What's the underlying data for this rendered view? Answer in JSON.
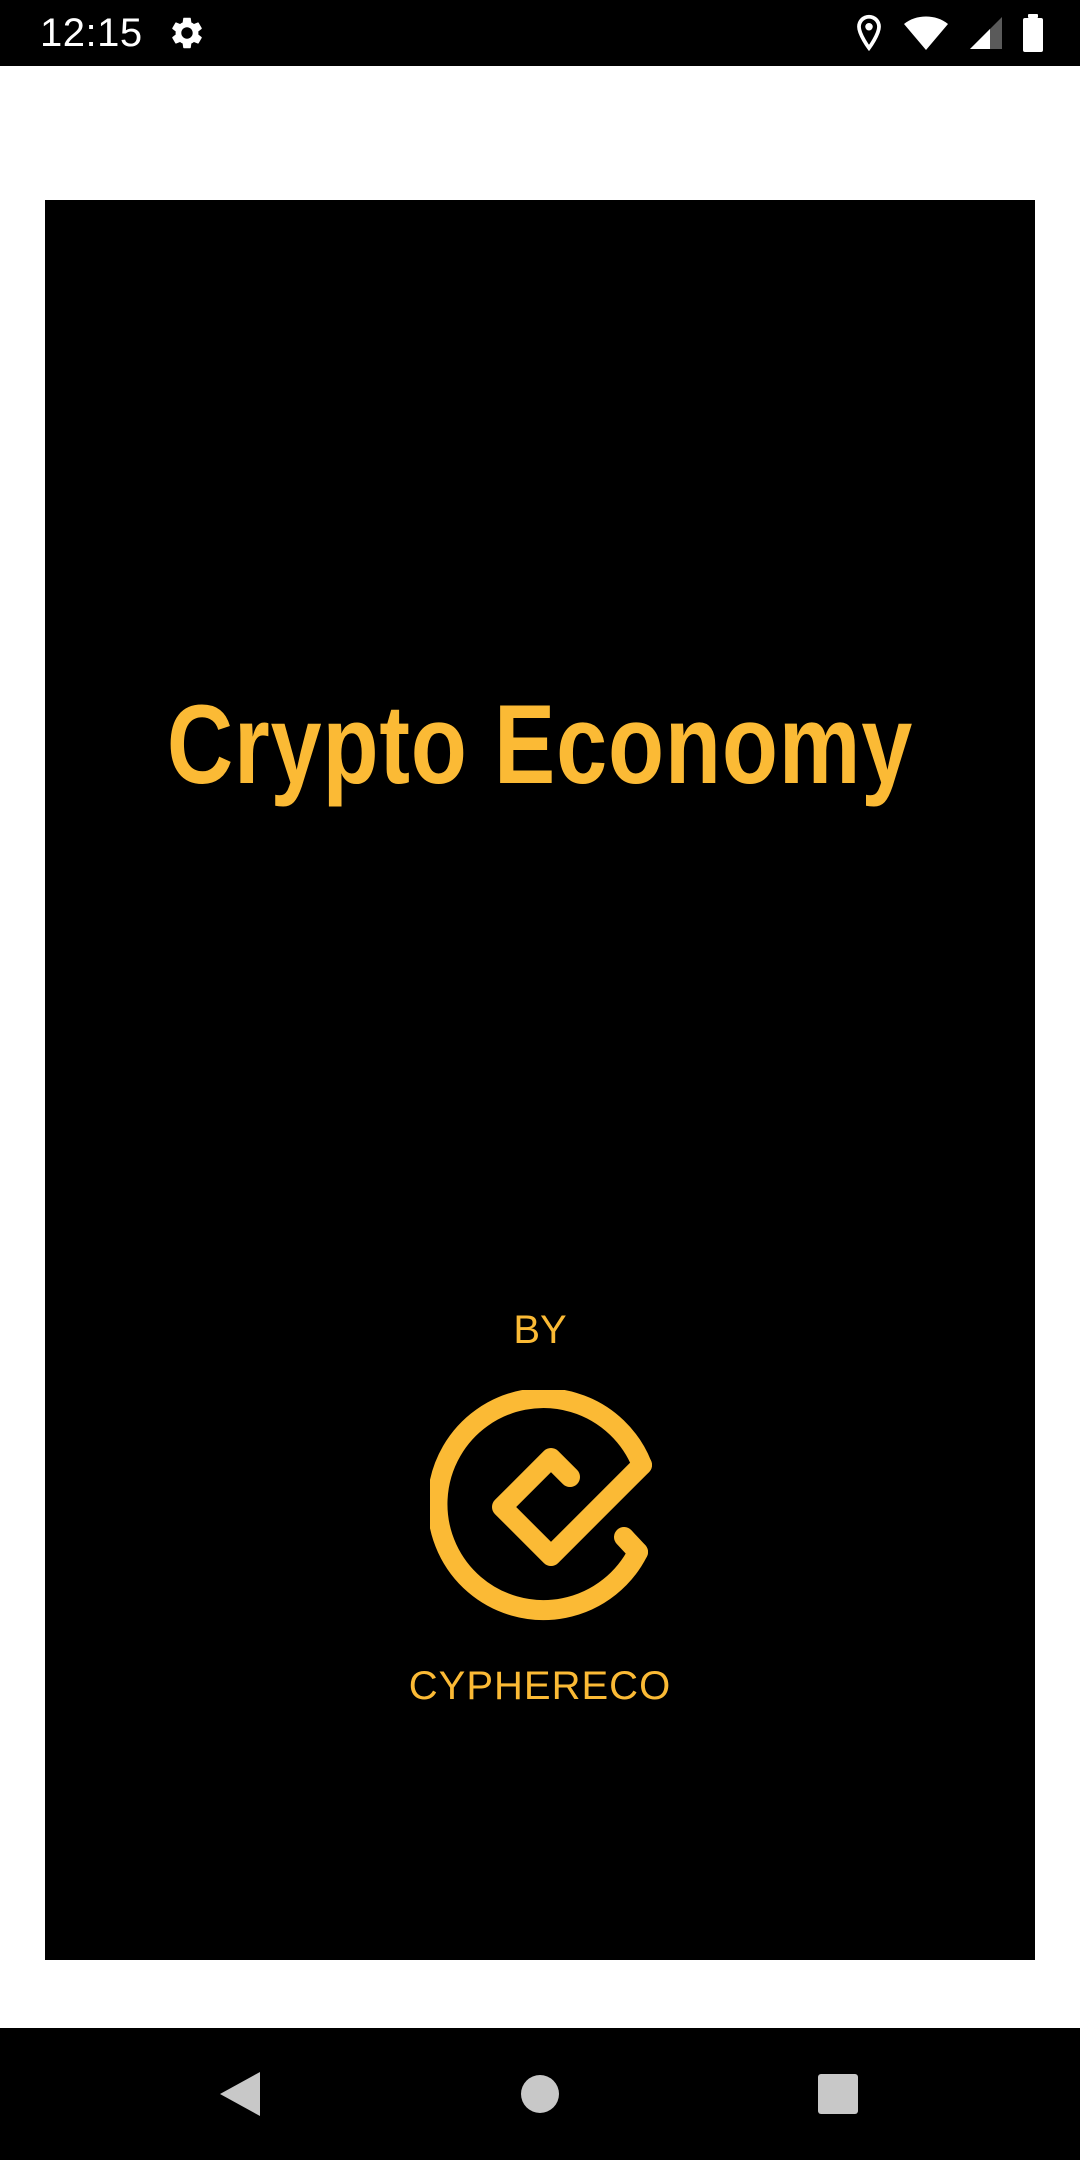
{
  "status_bar": {
    "time": "12:15",
    "icons": [
      "settings-gear-icon",
      "location-pin-icon",
      "wifi-icon",
      "cellular-signal-icon",
      "battery-icon"
    ]
  },
  "splash": {
    "title": "Crypto Economy",
    "by_label": "BY",
    "brand_name": "CYPHERECO",
    "brand_logo": "cyphereco-logo",
    "accent_color": "#FBBA35",
    "background_color": "#000000"
  },
  "navigation_bar": {
    "buttons": [
      "back",
      "home",
      "recents"
    ]
  }
}
